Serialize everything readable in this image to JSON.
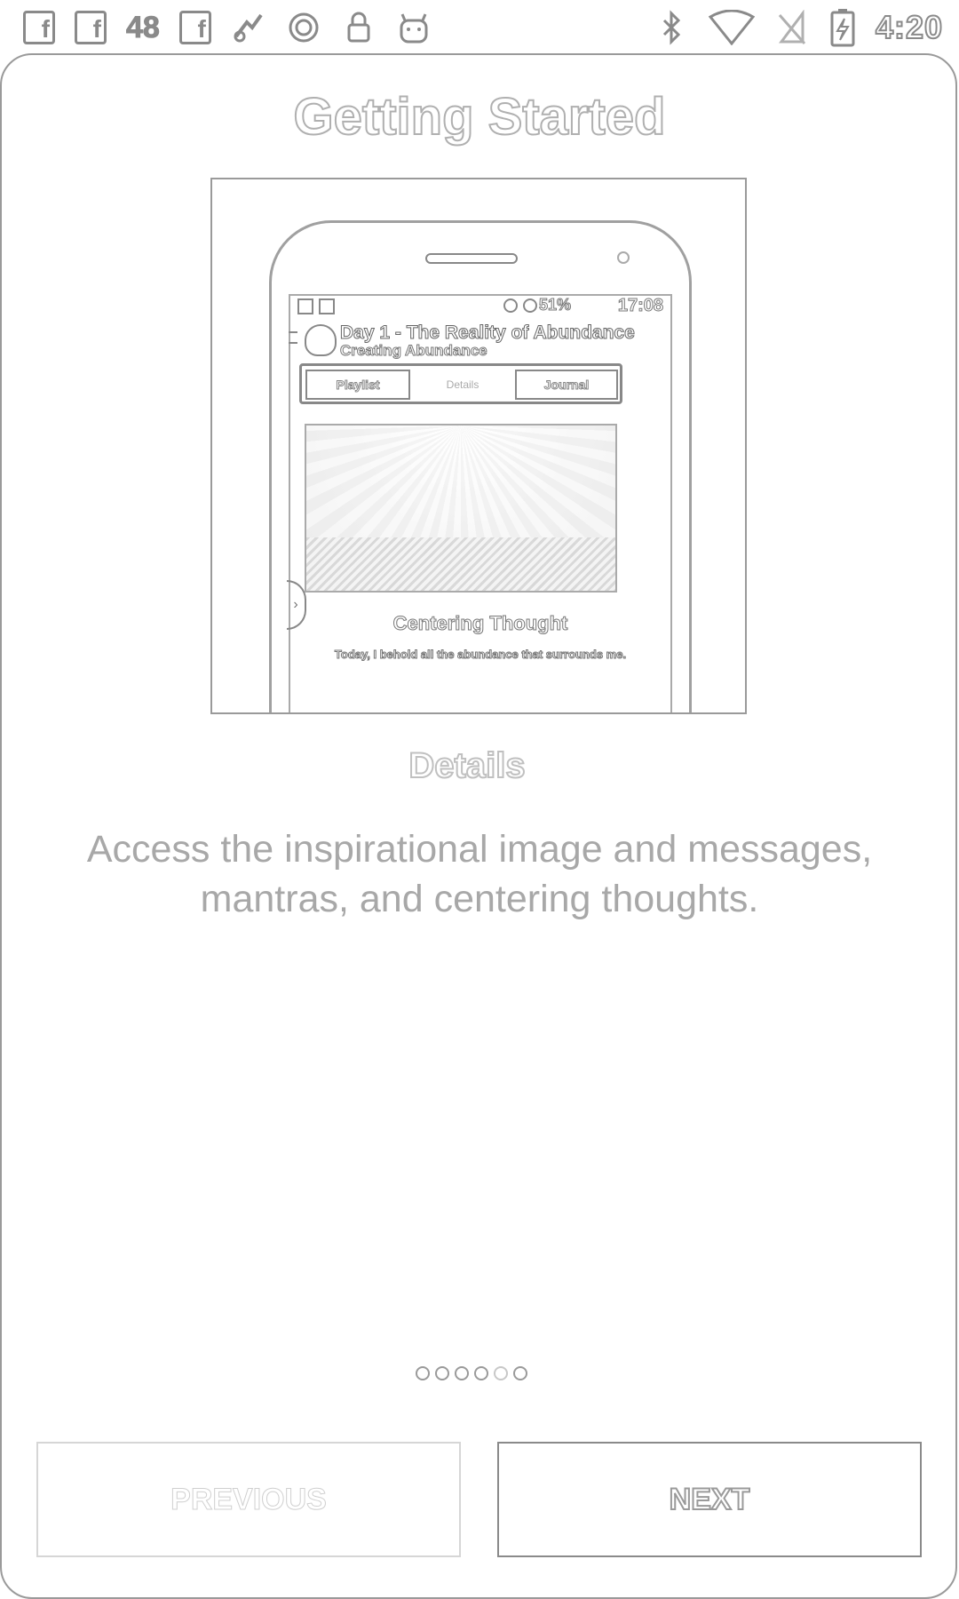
{
  "status_bar": {
    "badge_48": "48",
    "time": "4:20"
  },
  "title": "Getting Started",
  "preview": {
    "inner_time": "17:08",
    "inner_battery": "51%",
    "app_title": "Day 1 - The Reality of Abundance",
    "app_subtitle": "Creating Abundance",
    "tabs": [
      "Playlist",
      "Details",
      "Journal"
    ],
    "side_tab_glyph": "›",
    "centering_title": "Centering Thought",
    "centering_body": "Today, I behold all the abundance that surrounds me."
  },
  "section_title": "Details",
  "description": "Access the inspirational image and messages, mantras, and centering thoughts.",
  "pager": {
    "total": 6,
    "current_index": 4
  },
  "buttons": {
    "previous": "PREVIOUS",
    "next": "NEXT"
  }
}
